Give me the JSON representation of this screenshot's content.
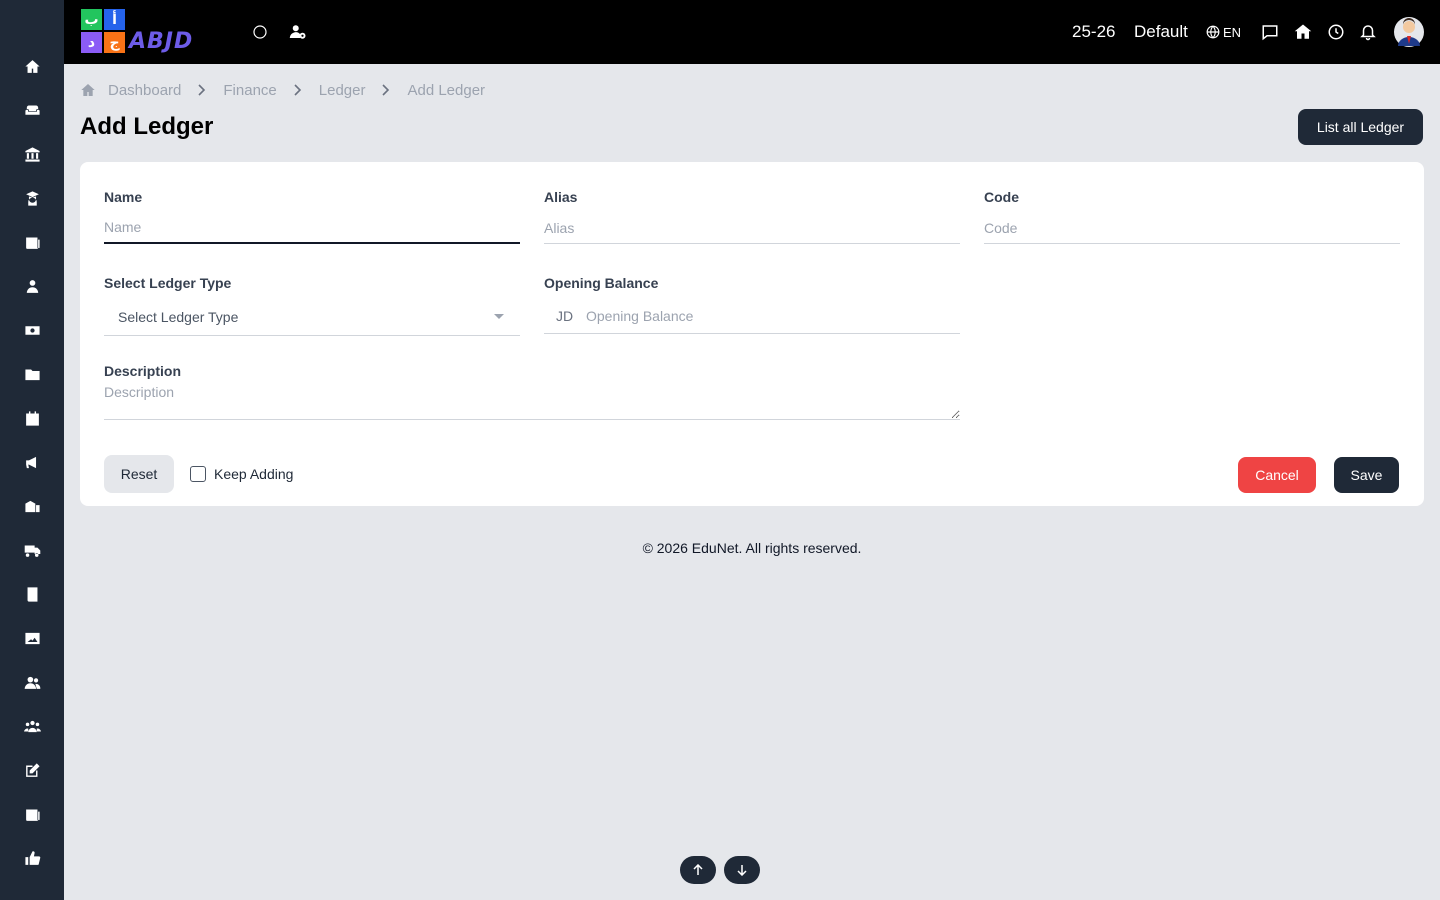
{
  "colors": {
    "sidebar_bg": "#1f2937",
    "topbar_bg": "#000000",
    "page_bg": "#e5e7eb",
    "primary": "#1f2937",
    "danger": "#ef4444",
    "logo_accent": "#6d5ce8"
  },
  "sidebar": {
    "items": [
      {
        "icon": "home-icon"
      },
      {
        "icon": "sofa-icon"
      },
      {
        "icon": "bank-icon"
      },
      {
        "icon": "graduate-icon"
      },
      {
        "icon": "newspaper-icon"
      },
      {
        "icon": "user-icon"
      },
      {
        "icon": "money-icon"
      },
      {
        "icon": "folder-icon"
      },
      {
        "icon": "calendar-icon"
      },
      {
        "icon": "megaphone-icon"
      },
      {
        "icon": "school-icon"
      },
      {
        "icon": "truck-icon"
      },
      {
        "icon": "book-icon"
      },
      {
        "icon": "image-icon"
      },
      {
        "icon": "users-icon"
      },
      {
        "icon": "group-icon"
      },
      {
        "icon": "edit-icon"
      },
      {
        "icon": "list-icon"
      },
      {
        "icon": "thumbs-up-icon"
      }
    ]
  },
  "topbar": {
    "logo_text": "ABJD",
    "logo_tiles": [
      "ب",
      "أ",
      "د",
      "ج"
    ],
    "session": "25-26",
    "profile": "Default",
    "language": "EN"
  },
  "breadcrumb": {
    "items": [
      "Dashboard",
      "Finance",
      "Ledger"
    ],
    "current": "Add Ledger"
  },
  "page": {
    "title": "Add Ledger",
    "list_button": "List all Ledger"
  },
  "form": {
    "name": {
      "label": "Name",
      "placeholder": "Name",
      "value": ""
    },
    "alias": {
      "label": "Alias",
      "placeholder": "Alias",
      "value": ""
    },
    "code": {
      "label": "Code",
      "placeholder": "Code",
      "value": ""
    },
    "ledger_type": {
      "label": "Select Ledger Type",
      "selected": "Select Ledger Type"
    },
    "opening_balance": {
      "label": "Opening Balance",
      "currency": "JD",
      "placeholder": "Opening Balance",
      "value": ""
    },
    "description": {
      "label": "Description",
      "placeholder": "Description",
      "value": ""
    },
    "reset_label": "Reset",
    "keep_adding_label": "Keep Adding",
    "keep_adding_checked": false,
    "cancel_label": "Cancel",
    "save_label": "Save"
  },
  "footer": {
    "text": "© 2026 EduNet. All rights reserved."
  }
}
